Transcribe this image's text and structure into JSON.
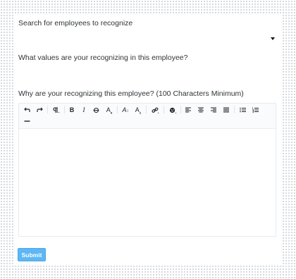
{
  "form": {
    "search_label": "Search for employees to recognize",
    "values_label": "What values are your recognizing in this employee?",
    "why_label": "Why are your recognizing this employee? (100 Characters Minimum)",
    "submit_label": "Submit"
  },
  "toolbar": {
    "bold": "B",
    "italic": "I",
    "font_color": "A",
    "font_size": "A",
    "clear_format": "A"
  },
  "colors": {
    "submit_bg": "#5db7f4",
    "toolbar_bg": "#f9fbfc"
  }
}
